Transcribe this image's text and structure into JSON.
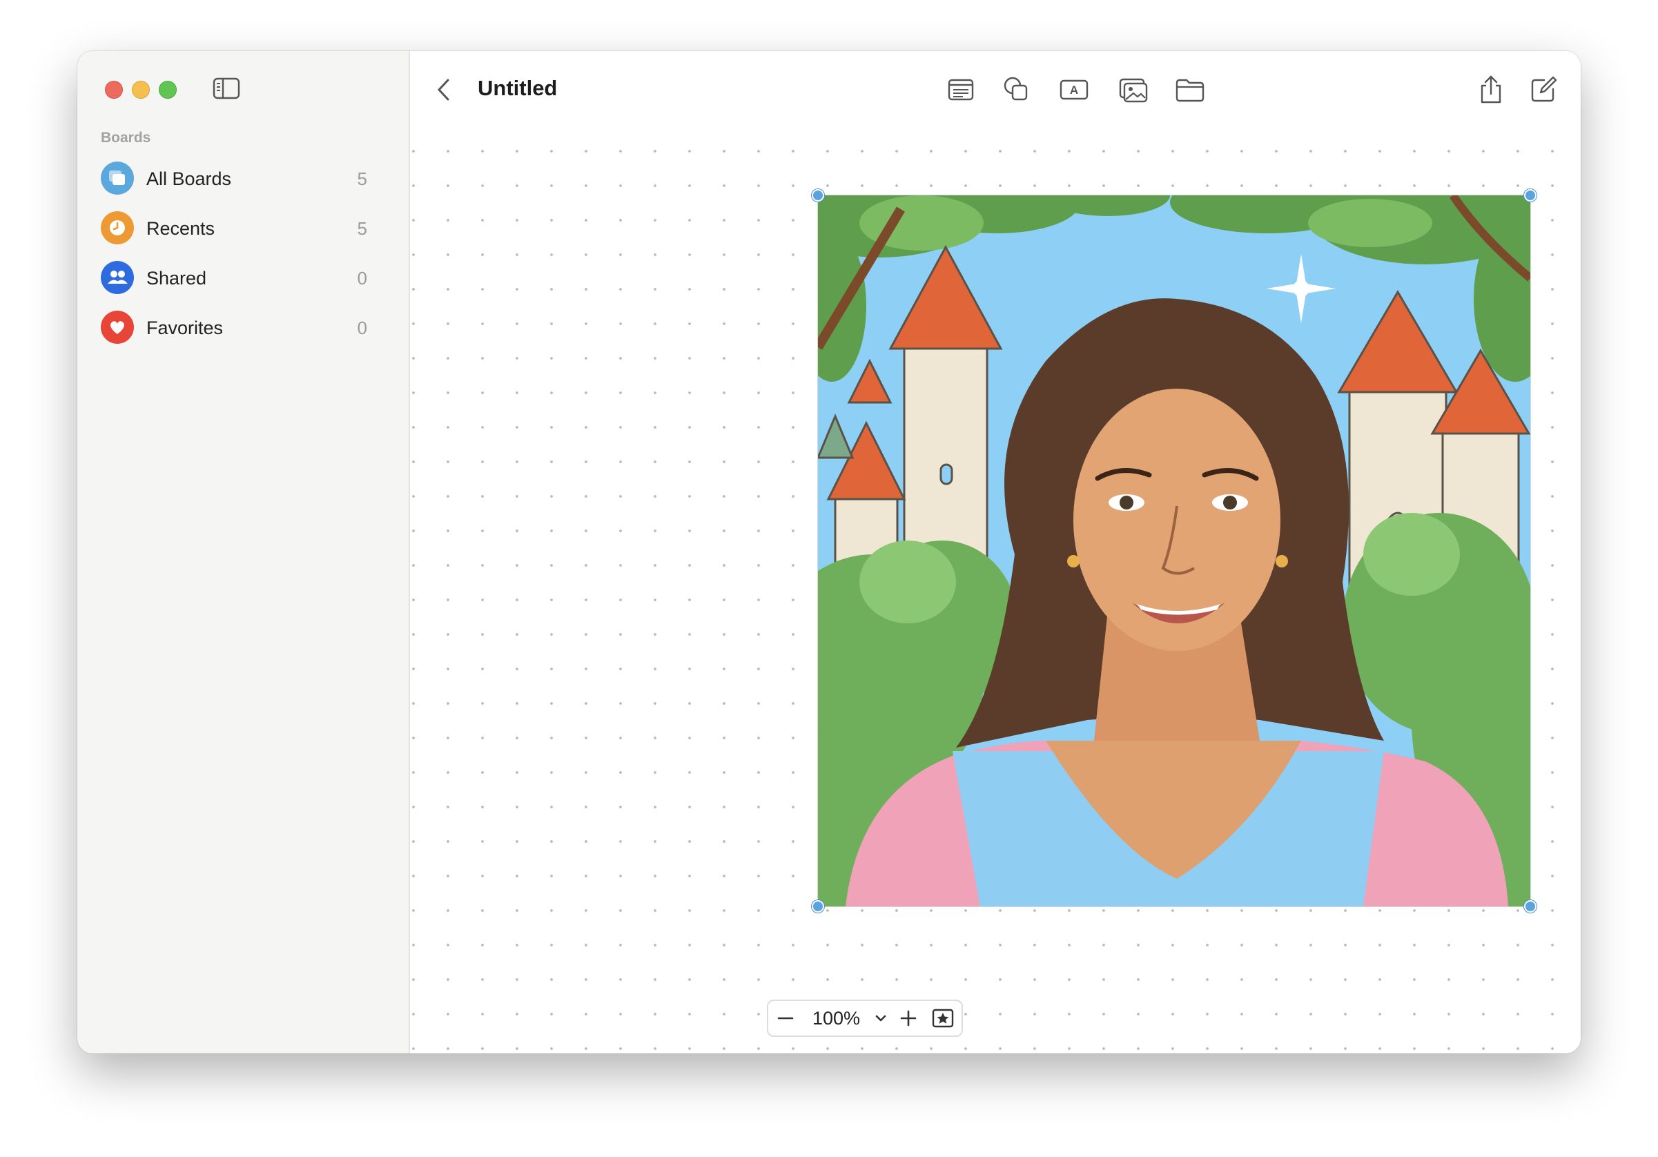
{
  "window": {
    "title": "Untitled"
  },
  "sidebar": {
    "heading": "Boards",
    "items": [
      {
        "label": "All Boards",
        "count": "5",
        "icon": "boards-stack-icon",
        "color": "#5ba8dc"
      },
      {
        "label": "Recents",
        "count": "5",
        "icon": "clock-icon",
        "color": "#ee9a34"
      },
      {
        "label": "Shared",
        "count": "0",
        "icon": "people-icon",
        "color": "#2e6bde"
      },
      {
        "label": "Favorites",
        "count": "0",
        "icon": "heart-icon",
        "color": "#e64538"
      }
    ]
  },
  "toolbar": {
    "tools": [
      "sticky-note-icon",
      "shapes-icon",
      "text-box-icon",
      "media-icon",
      "folder-icon"
    ],
    "actions": [
      "share-icon",
      "compose-icon"
    ]
  },
  "canvas": {
    "selected_item": "illustrated portrait image"
  },
  "zoom": {
    "value": "100%"
  },
  "colors": {
    "selection": "#5aa3e0",
    "sidebar_bg": "#f5f5f4"
  }
}
